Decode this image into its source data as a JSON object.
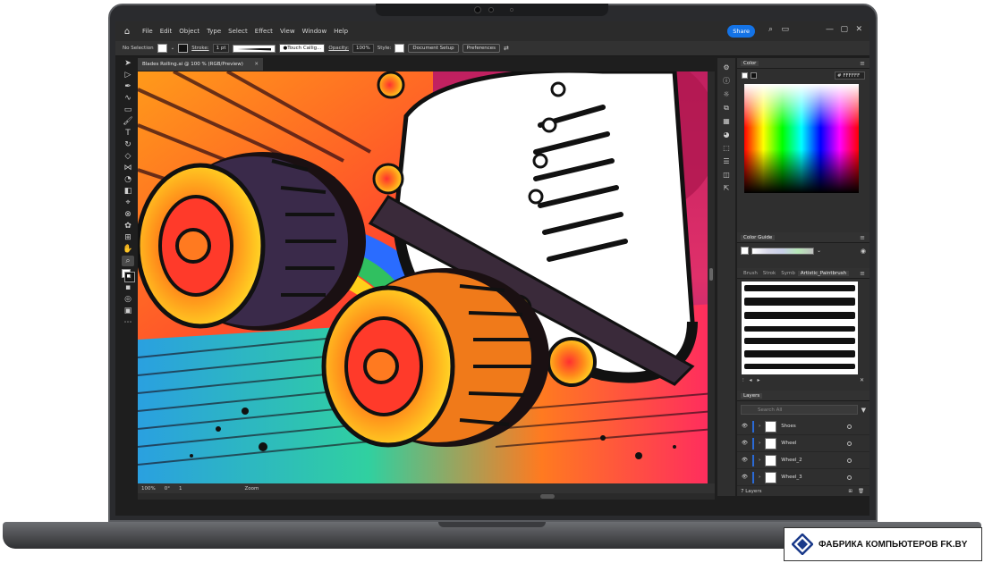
{
  "menu": {
    "items": [
      "File",
      "Edit",
      "Object",
      "Type",
      "Select",
      "Effect",
      "View",
      "Window",
      "Help"
    ],
    "share_label": "Share"
  },
  "control_bar": {
    "selection_label": "No Selection",
    "stroke_label": "Stroke:",
    "stroke_weight": "1 pt",
    "brush_name": "Touch Callig...",
    "opacity_label": "Opacity:",
    "opacity_value": "100%",
    "style_label": "Style:",
    "document_setup_label": "Document Setup",
    "preferences_label": "Preferences"
  },
  "document": {
    "tab_title": "Blades Rolling.ai @ 100 % (RGB/Preview)",
    "zoom": "100%",
    "rotation": "0°",
    "artboard": "1",
    "status_mode": "Zoom"
  },
  "color_panel": {
    "title": "Color",
    "hex_value": "FFFFFF"
  },
  "color_guide": {
    "title": "Color Guide"
  },
  "brushes_panel": {
    "tabs": [
      "Brush",
      "Strok",
      "Symb",
      "Artistic_Paintbrush"
    ]
  },
  "layers_panel": {
    "title": "Layers",
    "search_placeholder": "Search All",
    "layers": [
      {
        "name": "Shoes"
      },
      {
        "name": "Wheel"
      },
      {
        "name": "Wheel_2"
      },
      {
        "name": "Wheel_3"
      }
    ],
    "count_label": "7 Layers"
  },
  "brand": {
    "text": "ФАБРИКА КОМПЬЮТЕРОВ FK.BY"
  },
  "colors": {
    "accent": "#1473e6",
    "app_bg": "#323232"
  }
}
